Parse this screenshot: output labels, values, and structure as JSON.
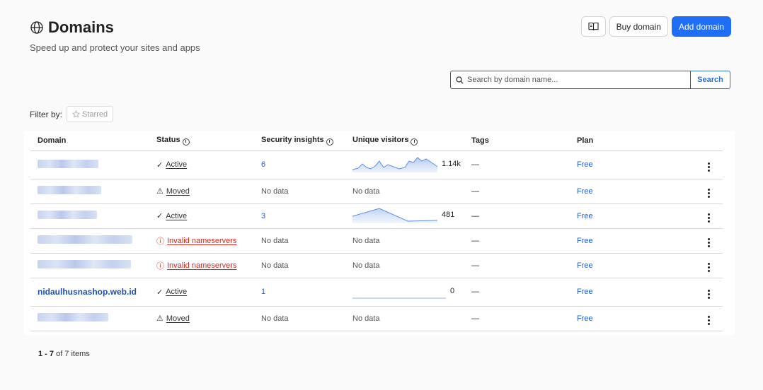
{
  "header": {
    "title": "Domains",
    "subtitle": "Speed up and protect your sites and apps",
    "buy_label": "Buy domain",
    "add_label": "Add domain"
  },
  "search": {
    "placeholder": "Search by domain name...",
    "button_label": "Search"
  },
  "filter": {
    "label": "Filter by:",
    "starred_label": "Starred"
  },
  "table": {
    "columns": [
      "Domain",
      "Status",
      "Security insights",
      "Unique visitors",
      "Tags",
      "Plan"
    ],
    "rows": [
      {
        "domain": "",
        "status": "Active",
        "security": "6",
        "visitors": "1.14k",
        "tags": "—",
        "plan": "Free"
      },
      {
        "domain": "",
        "status": "Moved",
        "security": "No data",
        "visitors": "No data",
        "tags": "—",
        "plan": "Free"
      },
      {
        "domain": "",
        "status": "Active",
        "security": "3",
        "visitors": "481",
        "tags": "—",
        "plan": "Free"
      },
      {
        "domain": "",
        "status": "Invalid nameservers",
        "security": "No data",
        "visitors": "No data",
        "tags": "—",
        "plan": "Free"
      },
      {
        "domain": "",
        "status": "Invalid nameservers",
        "security": "No data",
        "visitors": "No data",
        "tags": "—",
        "plan": "Free"
      },
      {
        "domain": "nidaulhusnashop.web.id",
        "status": "Active",
        "security": "1",
        "visitors": "0",
        "tags": "—",
        "plan": "Free"
      },
      {
        "domain": "",
        "status": "Moved",
        "security": "No data",
        "visitors": "No data",
        "tags": "—",
        "plan": "Free"
      }
    ]
  },
  "footer": {
    "range": "1 - 7",
    "suffix": "of 7 items"
  },
  "colors": {
    "primary": "#1f6ef5",
    "link": "#1f5cc9",
    "error": "#d9271a"
  }
}
